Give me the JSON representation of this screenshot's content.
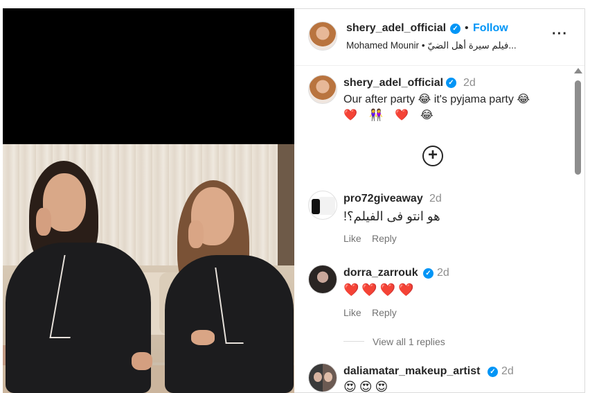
{
  "post": {
    "author": "shery_adel_official",
    "verified_mark": "✓",
    "separator": "•",
    "follow_label": "Follow",
    "more_label": "···",
    "subline_artist": "Mohamed Mounir",
    "subline_sep": "•",
    "subline_song": "فيلم سيرة أهل الضيّ",
    "subline_ellipsis": "..."
  },
  "caption": {
    "author": "shery_adel_official",
    "time": "2d",
    "text_1": "Our after party",
    "emoji_1": "😂",
    "text_2": "it's pyjama party",
    "emoji_2": "😂",
    "emoji_row": "❤️ 👭 ❤️ 😂"
  },
  "load_more_label": "+",
  "comments": [
    {
      "author": "pro72giveaway",
      "time": "2d",
      "text": "هو انتو فى الفيلم؟!",
      "like_label": "Like",
      "reply_label": "Reply"
    },
    {
      "author": "dorra_zarrouk",
      "time": "2d",
      "text": "❤️❤️❤️❤️",
      "like_label": "Like",
      "reply_label": "Reply",
      "view_replies": "View all 1 replies"
    },
    {
      "author": "daliamatar_makeup_artist",
      "time": "2d",
      "text": "😍😍😍"
    }
  ],
  "colors": {
    "accent": "#0095f6",
    "text": "#262626",
    "muted": "#737373",
    "heart": "#ed4956"
  },
  "icons": {
    "verified": "verified-badge-icon",
    "more": "more-options-icon",
    "load_more": "plus-circle-icon"
  }
}
